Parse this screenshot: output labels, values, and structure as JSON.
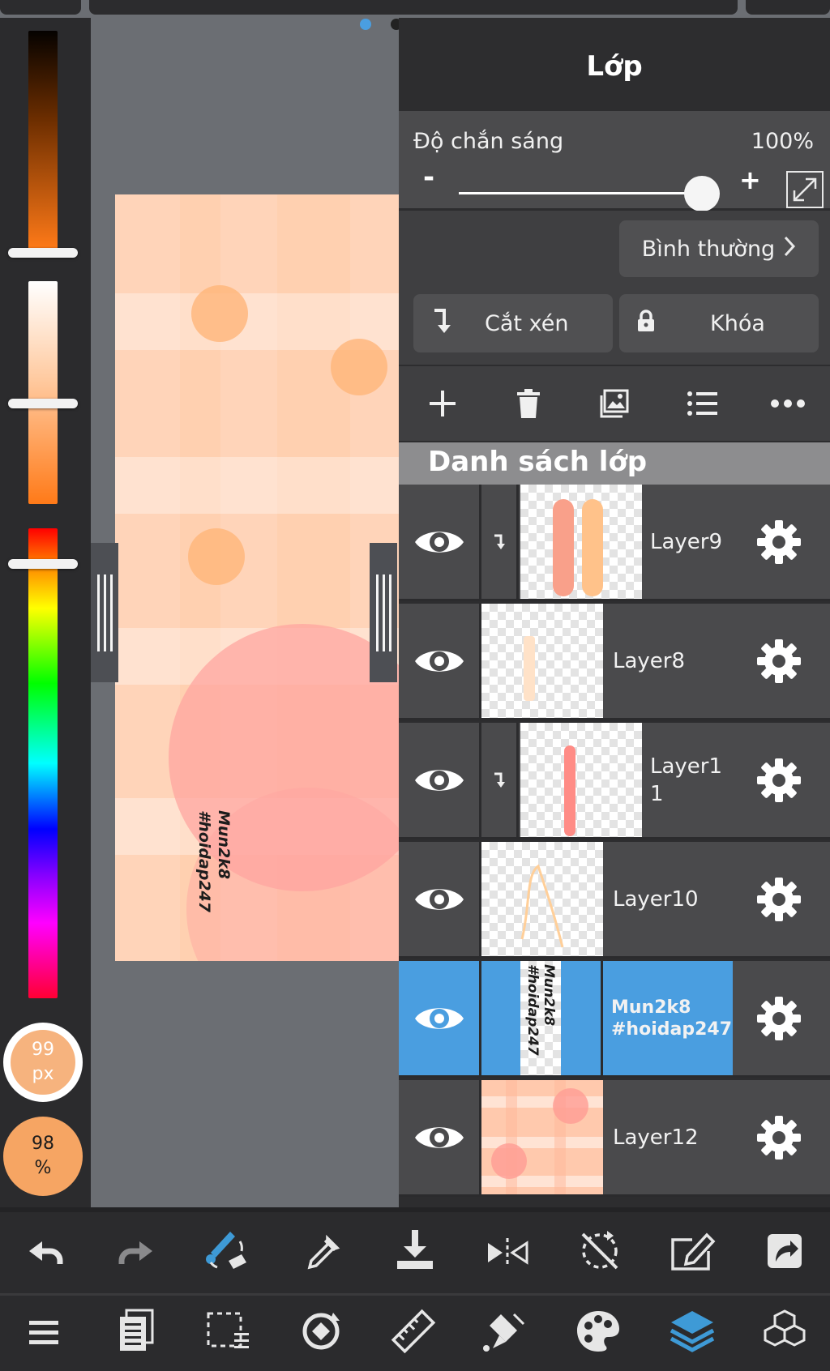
{
  "layer_panel": {
    "title": "Lớp",
    "opacity_label": "Độ chắn sáng",
    "opacity_value": "100%",
    "minus_label": "-",
    "plus_label": "+",
    "blend_mode": "Bình thường",
    "clip_label": "Cắt xén",
    "lock_label": "Khóa",
    "list_title": "Danh sách lớp",
    "opacity_level": 1.0
  },
  "layers": [
    {
      "name": "Layer9",
      "clipped": true,
      "visible": true,
      "selected": false
    },
    {
      "name": "Layer8",
      "clipped": false,
      "visible": true,
      "selected": false
    },
    {
      "name": "Layer1\n1",
      "clipped": true,
      "visible": true,
      "selected": false
    },
    {
      "name": "Layer10",
      "clipped": false,
      "visible": true,
      "selected": false
    },
    {
      "name": "Mun2k8\n#hoidap247",
      "clipped": false,
      "visible": true,
      "selected": true
    },
    {
      "name": "Layer12",
      "clipped": false,
      "visible": true,
      "selected": false
    }
  ],
  "brush": {
    "size_value": "99",
    "size_unit": "px",
    "opacity_value": "98",
    "opacity_unit": "%"
  },
  "canvas": {
    "text_line1": "Mun2k8",
    "text_line2": "#hoidap247"
  },
  "icons": {
    "layer_tools": [
      "add-layer-icon",
      "delete-layer-icon",
      "import-image-icon",
      "layer-list-icon",
      "more-icon"
    ],
    "bottom_row1": [
      "undo-icon",
      "redo-icon",
      "brush-swap-icon",
      "eyedropper-icon",
      "download-icon",
      "flip-icon",
      "rotate-reset-icon",
      "edit-canvas-icon",
      "share-icon"
    ],
    "bottom_row2": [
      "menu-icon",
      "pages-icon",
      "selection-icon",
      "transform-icon",
      "ruler-icon",
      "fill-icon",
      "palette-icon",
      "layers-icon",
      "materials-icon"
    ]
  },
  "colors": {
    "accent": "#4a9ee0",
    "panel_bg": "#2d2d2f",
    "canvas_bg": "#ffd4b9"
  }
}
